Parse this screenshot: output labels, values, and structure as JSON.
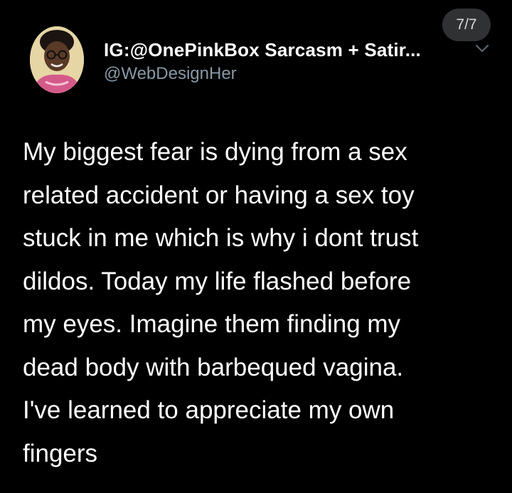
{
  "tweet": {
    "display_name": "IG:@OnePinkBox Sarcasm + Satir...",
    "handle": "@WebDesignHer",
    "counter": "7/7",
    "menu_icon": "chevron-down-icon",
    "avatar_icon": "profile-avatar",
    "body_lines": [
      "My biggest fear is dying from a sex",
      "related accident or having a sex toy",
      "stuck in me which is why i dont trust",
      "dildos. Today my life flashed before",
      "my eyes. Imagine them finding my",
      "dead body with barbequed vagina.",
      "I've learned to appreciate my own",
      "fingers"
    ]
  },
  "colors": {
    "background": "#000000",
    "primary_text": "#ffffff",
    "secondary_text": "#8899a6",
    "counter_pill": "#2f3133"
  }
}
